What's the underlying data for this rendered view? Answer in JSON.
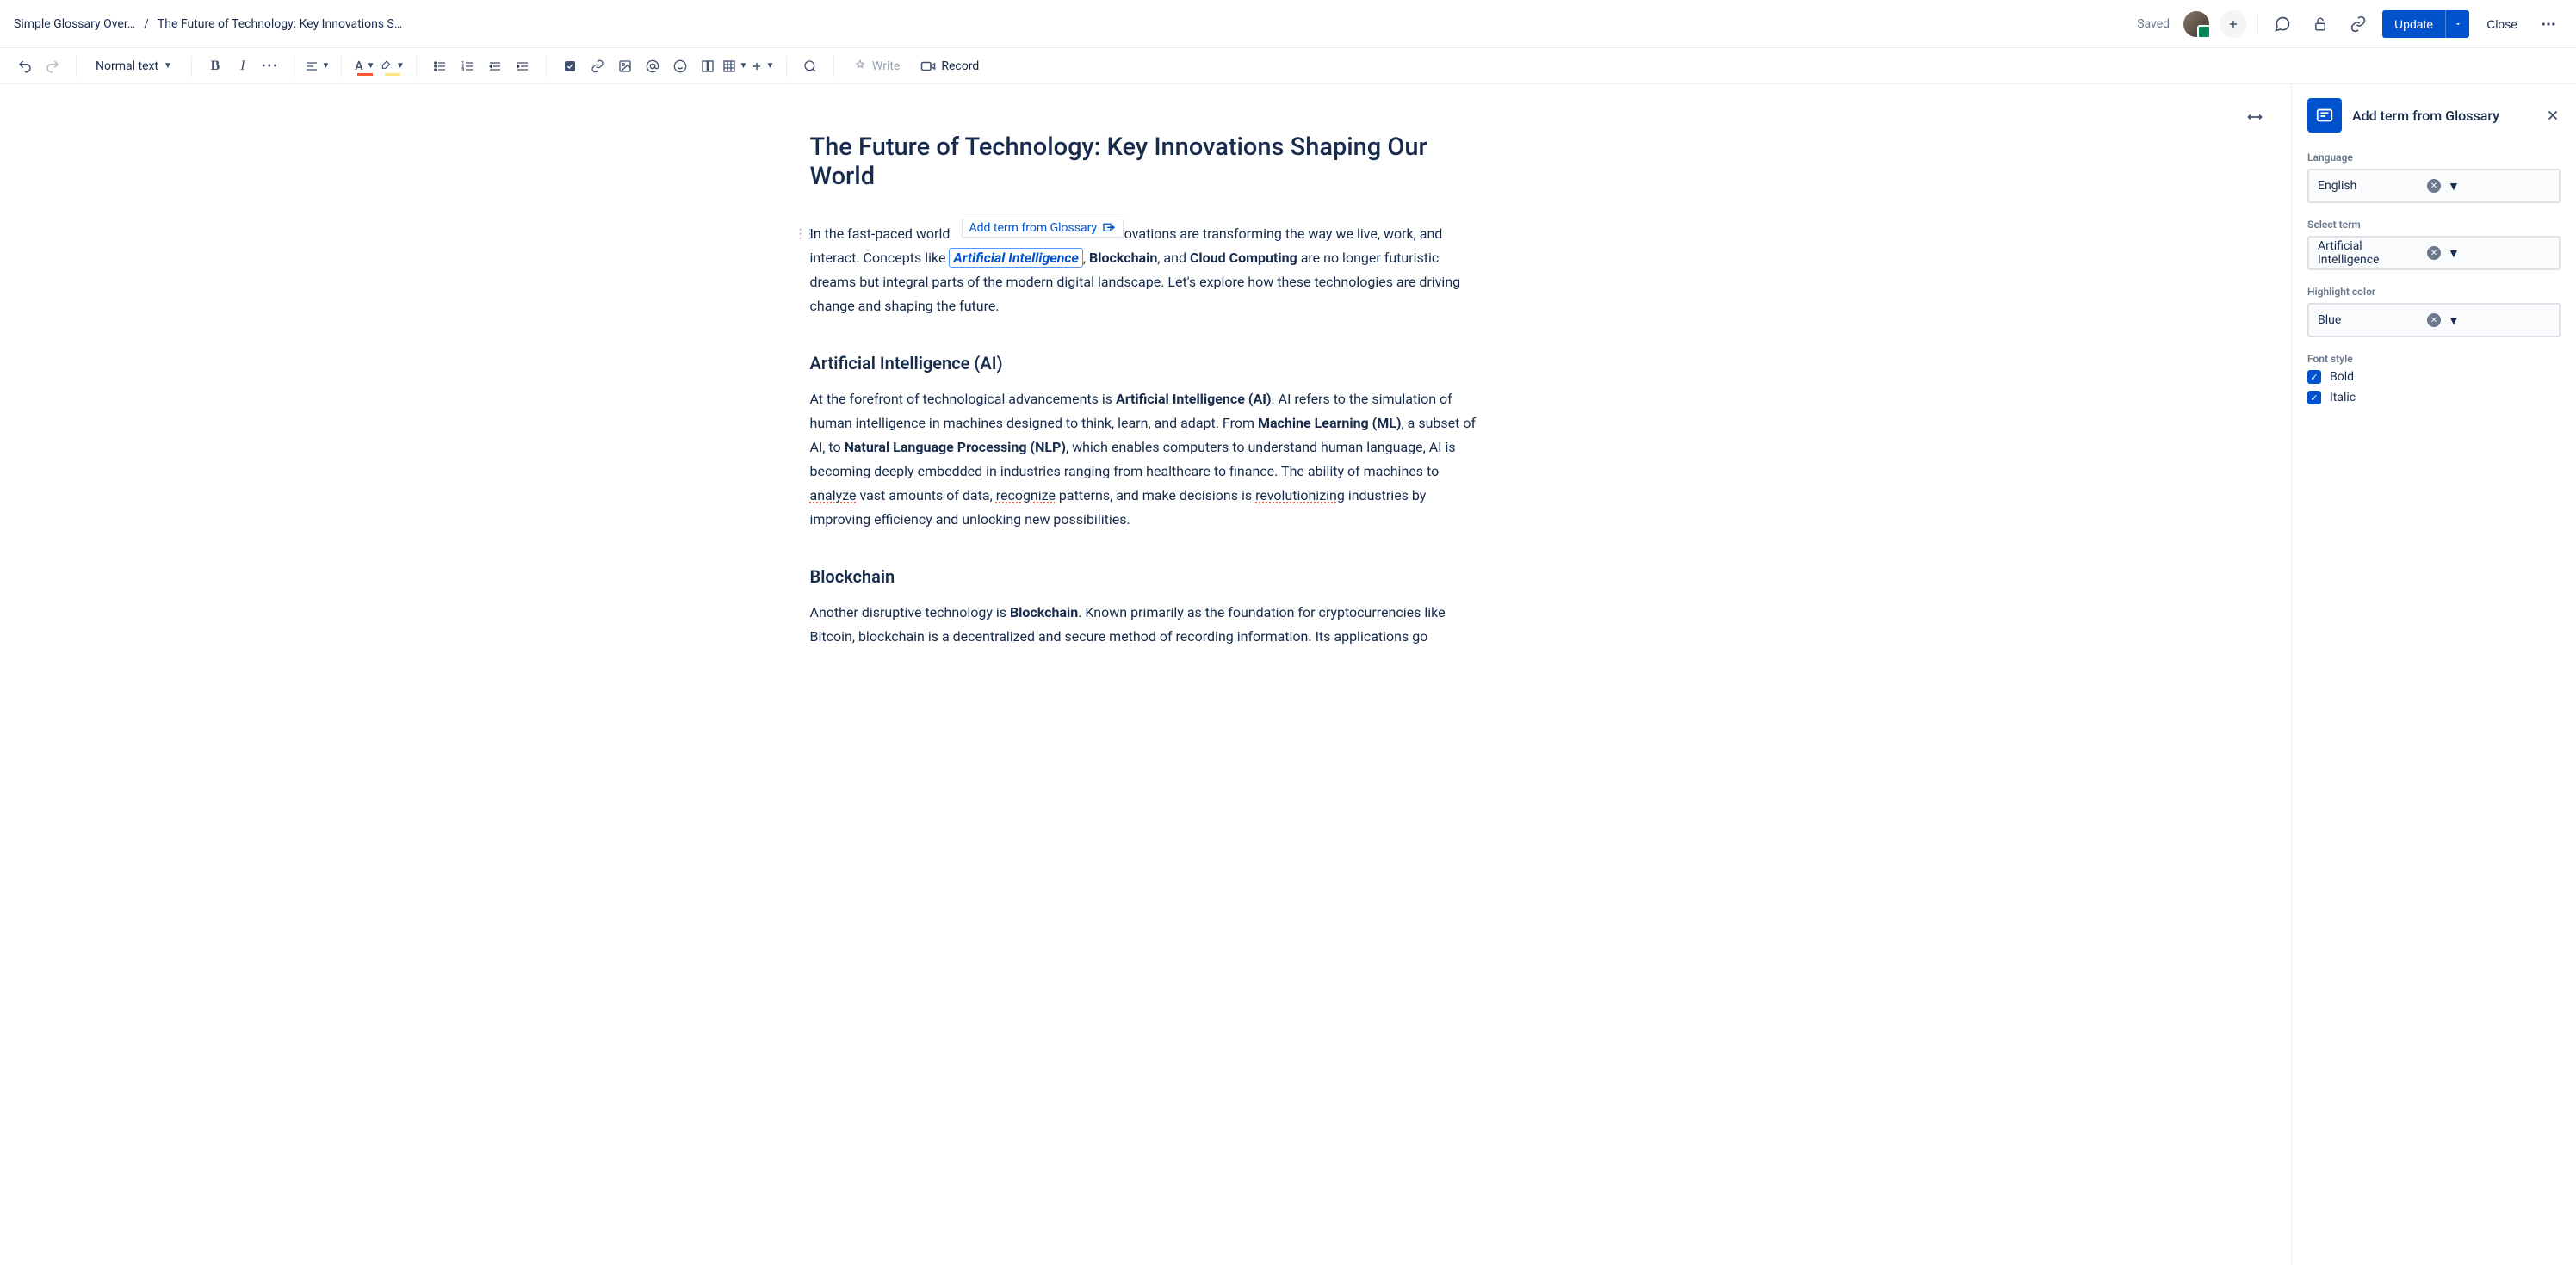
{
  "breadcrumb": {
    "parent": "Simple Glossary Over…",
    "sep": "/",
    "current": "The Future of Technology: Key Innovations S…"
  },
  "header": {
    "saved": "Saved",
    "update": "Update",
    "close": "Close"
  },
  "toolbar": {
    "textStyle": "Normal text",
    "write": "Write",
    "record": "Record"
  },
  "doc": {
    "title": "The Future of Technology: Key Innovations Shaping Our World",
    "floating_tag": "Add term from Glossary",
    "p1_a": "In the fast-paced world",
    "p1_b": "ovations are transforming the way we live, work, and interact. Concepts like ",
    "term": "Artificial Intelligence",
    "p1_c": ", ",
    "bold_blockchain": "Blockchain",
    "p1_d": ", and ",
    "bold_cloud": "Cloud Computing",
    "p1_e": " are no longer futuristic dreams but integral parts of the modern digital landscape. Let's explore how these technologies are driving change and shaping the future.",
    "h2_ai": "Artificial Intelligence (AI)",
    "p2_a": "At the forefront of technological advancements is ",
    "bold_ai": "Artificial Intelligence (AI)",
    "p2_b": ". AI refers to the simulation of human intelligence in machines designed to think, learn, and adapt. From ",
    "bold_ml": "Machine Learning (ML)",
    "p2_c": ", a subset of AI, to ",
    "bold_nlp": "Natural Language Processing (NLP)",
    "p2_d": ", which enables computers to understand human language, AI is becoming deeply embedded in industries ranging from healthcare to finance. The ability of machines to ",
    "dotted_analyze": "analyze",
    "p2_e": " vast amounts of data, ",
    "dotted_recognize": "recognize",
    "p2_f": " patterns, and make decisions is ",
    "dotted_revolution": "revolutionizing",
    "p2_g": " industries by improving efficiency and unlocking new possibilities.",
    "h2_block": "Blockchain",
    "p3_a": "Another disruptive technology is ",
    "bold_block2": "Blockchain",
    "p3_b": ". Known primarily as the foundation for cryptocurrencies like Bitcoin, blockchain is a decentralized and secure method of recording information. Its applications go"
  },
  "panel": {
    "title": "Add term from Glossary",
    "lang_label": "Language",
    "lang_value": "English",
    "term_label": "Select term",
    "term_value": "Artificial Intelligence",
    "color_label": "Highlight color",
    "color_value": "Blue",
    "font_label": "Font style",
    "bold_label": "Bold",
    "italic_label": "Italic"
  }
}
